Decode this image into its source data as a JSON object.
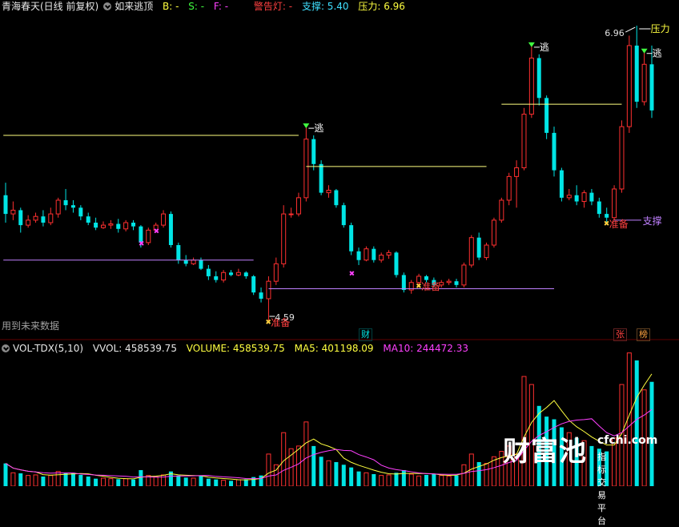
{
  "header": {
    "title": "青海春天(日线 前复权)",
    "indicator_name": "如来逃顶",
    "b_label": "B: -",
    "s_label": "S: -",
    "f_label": "F: -",
    "warning_label": "警告灯: -",
    "support_label": "支撑: 5.40",
    "pressure_label": "压力: 6.96"
  },
  "vol_header": {
    "name": "VOL-TDX(5,10)",
    "vvol": "VVOL: 458539.75",
    "volume": "VOLUME: 458539.75",
    "ma5": "MA5: 401198.09",
    "ma10": "MA10: 244472.33"
  },
  "future_data_note": "用到未来数据",
  "badges": {
    "cai": "财",
    "zhang": "张",
    "bang": "榜"
  },
  "watermark": {
    "big": "财富池",
    "site": "cfchi.com",
    "sub": "指标交易平台"
  },
  "colors": {
    "up": "#ff3030",
    "down": "#00e5e5",
    "ma5": "#ffff40",
    "ma10": "#ff40ff",
    "support": "#c080ff",
    "pressure": "#ffff80"
  },
  "chart_data": [
    {
      "type": "candlestick",
      "title": "青海春天(日线 前复权)",
      "series": [
        {
          "name": "价格",
          "ohlc": [
            [
              5.6,
              5.7,
              5.38,
              5.45
            ],
            [
              5.45,
              5.55,
              5.4,
              5.48
            ],
            [
              5.48,
              5.5,
              5.3,
              5.36
            ],
            [
              5.36,
              5.44,
              5.34,
              5.4
            ],
            [
              5.4,
              5.46,
              5.38,
              5.43
            ],
            [
              5.43,
              5.48,
              5.35,
              5.38
            ],
            [
              5.38,
              5.5,
              5.36,
              5.45
            ],
            [
              5.45,
              5.58,
              5.42,
              5.56
            ],
            [
              5.56,
              5.65,
              5.48,
              5.52
            ],
            [
              5.52,
              5.56,
              5.46,
              5.5
            ],
            [
              5.5,
              5.52,
              5.4,
              5.43
            ],
            [
              5.43,
              5.46,
              5.36,
              5.38
            ],
            [
              5.38,
              5.42,
              5.32,
              5.34
            ],
            [
              5.34,
              5.39,
              5.33,
              5.36
            ],
            [
              5.36,
              5.4,
              5.33,
              5.37
            ],
            [
              5.37,
              5.41,
              5.3,
              5.33
            ],
            [
              5.33,
              5.4,
              5.31,
              5.38
            ],
            [
              5.38,
              5.4,
              5.32,
              5.35
            ],
            [
              5.35,
              5.36,
              5.18,
              5.22
            ],
            [
              5.22,
              5.34,
              5.2,
              5.32
            ],
            [
              5.32,
              5.38,
              5.3,
              5.36
            ],
            [
              5.36,
              5.48,
              5.34,
              5.45
            ],
            [
              5.45,
              5.47,
              5.18,
              5.2
            ],
            [
              5.2,
              5.22,
              5.05,
              5.08
            ],
            [
              5.08,
              5.12,
              5.03,
              5.05
            ],
            [
              5.05,
              5.1,
              5.04,
              5.08
            ],
            [
              5.08,
              5.1,
              5.0,
              5.01
            ],
            [
              5.01,
              5.04,
              4.92,
              4.95
            ],
            [
              4.95,
              4.99,
              4.9,
              4.92
            ],
            [
              4.92,
              5.0,
              4.9,
              4.98
            ],
            [
              4.98,
              5.0,
              4.95,
              4.96
            ],
            [
              4.96,
              5.01,
              4.95,
              4.98
            ],
            [
              4.98,
              4.99,
              4.93,
              4.95
            ],
            [
              4.95,
              4.96,
              4.8,
              4.82
            ],
            [
              4.82,
              4.86,
              4.74,
              4.77
            ],
            [
              4.77,
              4.95,
              4.59,
              4.91
            ],
            [
              4.91,
              5.1,
              4.88,
              5.05
            ],
            [
              5.05,
              5.52,
              5.02,
              5.45
            ],
            [
              5.45,
              5.5,
              5.42,
              5.45
            ],
            [
              5.45,
              5.62,
              5.43,
              5.58
            ],
            [
              5.58,
              6.15,
              5.55,
              6.05
            ],
            [
              6.05,
              6.08,
              5.8,
              5.85
            ],
            [
              5.85,
              5.88,
              5.6,
              5.62
            ],
            [
              5.62,
              5.68,
              5.58,
              5.64
            ],
            [
              5.64,
              5.65,
              5.5,
              5.52
            ],
            [
              5.52,
              5.54,
              5.34,
              5.36
            ],
            [
              5.36,
              5.38,
              5.12,
              5.15
            ],
            [
              5.15,
              5.18,
              5.04,
              5.08
            ],
            [
              5.08,
              5.19,
              5.07,
              5.17
            ],
            [
              5.17,
              5.19,
              5.06,
              5.08
            ],
            [
              5.08,
              5.14,
              5.06,
              5.12
            ],
            [
              5.12,
              5.16,
              5.09,
              5.14
            ],
            [
              5.14,
              5.15,
              4.94,
              4.96
            ],
            [
              4.96,
              4.98,
              4.82,
              4.84
            ],
            [
              4.84,
              4.92,
              4.81,
              4.9
            ],
            [
              4.9,
              4.97,
              4.88,
              4.95
            ],
            [
              4.95,
              4.96,
              4.9,
              4.92
            ],
            [
              4.92,
              4.94,
              4.86,
              4.88
            ],
            [
              4.88,
              4.92,
              4.86,
              4.9
            ],
            [
              4.9,
              4.93,
              4.88,
              4.91
            ],
            [
              4.91,
              4.93,
              4.86,
              4.88
            ],
            [
              4.88,
              5.06,
              4.86,
              5.04
            ],
            [
              5.04,
              5.28,
              5.02,
              5.26
            ],
            [
              5.26,
              5.3,
              5.08,
              5.1
            ],
            [
              5.1,
              5.22,
              5.08,
              5.2
            ],
            [
              5.2,
              5.42,
              5.18,
              5.4
            ],
            [
              5.4,
              5.58,
              5.38,
              5.56
            ],
            [
              5.56,
              5.78,
              5.52,
              5.75
            ],
            [
              5.75,
              5.88,
              5.5,
              5.82
            ],
            [
              5.82,
              6.3,
              5.8,
              6.25
            ],
            [
              6.25,
              6.8,
              6.22,
              6.7
            ],
            [
              6.7,
              6.73,
              6.32,
              6.38
            ],
            [
              6.38,
              6.4,
              6.05,
              6.1
            ],
            [
              6.1,
              6.15,
              5.75,
              5.8
            ],
            [
              5.8,
              5.82,
              5.55,
              5.58
            ],
            [
              5.58,
              5.65,
              5.56,
              5.6
            ],
            [
              5.6,
              5.68,
              5.52,
              5.55
            ],
            [
              5.55,
              5.64,
              5.5,
              5.62
            ],
            [
              5.62,
              5.65,
              5.52,
              5.55
            ],
            [
              5.55,
              5.58,
              5.42,
              5.45
            ],
            [
              5.45,
              5.5,
              5.38,
              5.42
            ],
            [
              5.42,
              5.68,
              5.4,
              5.65
            ],
            [
              5.65,
              6.2,
              5.62,
              6.15
            ],
            [
              6.15,
              6.88,
              6.1,
              6.8
            ],
            [
              6.8,
              6.96,
              6.3,
              6.35
            ],
            [
              6.35,
              6.75,
              6.32,
              6.65
            ],
            [
              6.65,
              6.8,
              6.22,
              6.28
            ]
          ]
        }
      ],
      "annotations": [
        {
          "text": "逃",
          "type": "escape"
        },
        {
          "text": "逃",
          "type": "escape"
        },
        {
          "text": "逃",
          "type": "escape"
        },
        {
          "text": "准备",
          "type": "ready"
        },
        {
          "text": "准备",
          "type": "ready"
        },
        {
          "text": "准备",
          "type": "ready"
        },
        {
          "text": "支撑",
          "type": "support",
          "value": 5.4
        },
        {
          "text": "压力",
          "type": "pressure",
          "value": 6.96
        },
        {
          "text": "4.59",
          "type": "low",
          "value": 4.59
        },
        {
          "text": "6.96",
          "type": "high",
          "value": 6.96
        }
      ],
      "ylim": [
        4.5,
        7.05
      ]
    },
    {
      "type": "bar",
      "title": "VOL-TDX(5,10)",
      "series": [
        {
          "name": "VOLUME",
          "values": [
            85000,
            50000,
            48000,
            40000,
            42000,
            36000,
            40000,
            55000,
            48000,
            50000,
            42000,
            36000,
            28000,
            30000,
            28000,
            26000,
            28000,
            25000,
            60000,
            40000,
            35000,
            42000,
            55000,
            40000,
            32000,
            30000,
            38000,
            28000,
            25000,
            22000,
            20000,
            24000,
            26000,
            34000,
            40000,
            120000,
            80000,
            200000,
            140000,
            150000,
            240000,
            150000,
            110000,
            95000,
            90000,
            80000,
            70000,
            55000,
            50000,
            45000,
            40000,
            42000,
            50000,
            60000,
            45000,
            38000,
            42000,
            45000,
            40000,
            38000,
            40000,
            80000,
            120000,
            90000,
            85000,
            110000,
            130000,
            150000,
            120000,
            410000,
            380000,
            300000,
            260000,
            250000,
            220000,
            200000,
            180000,
            170000,
            150000,
            140000,
            130000,
            180000,
            380000,
            498000,
            470000,
            360000,
            390000
          ]
        },
        {
          "name": "MA5",
          "values": []
        },
        {
          "name": "MA10",
          "values": []
        }
      ]
    }
  ]
}
